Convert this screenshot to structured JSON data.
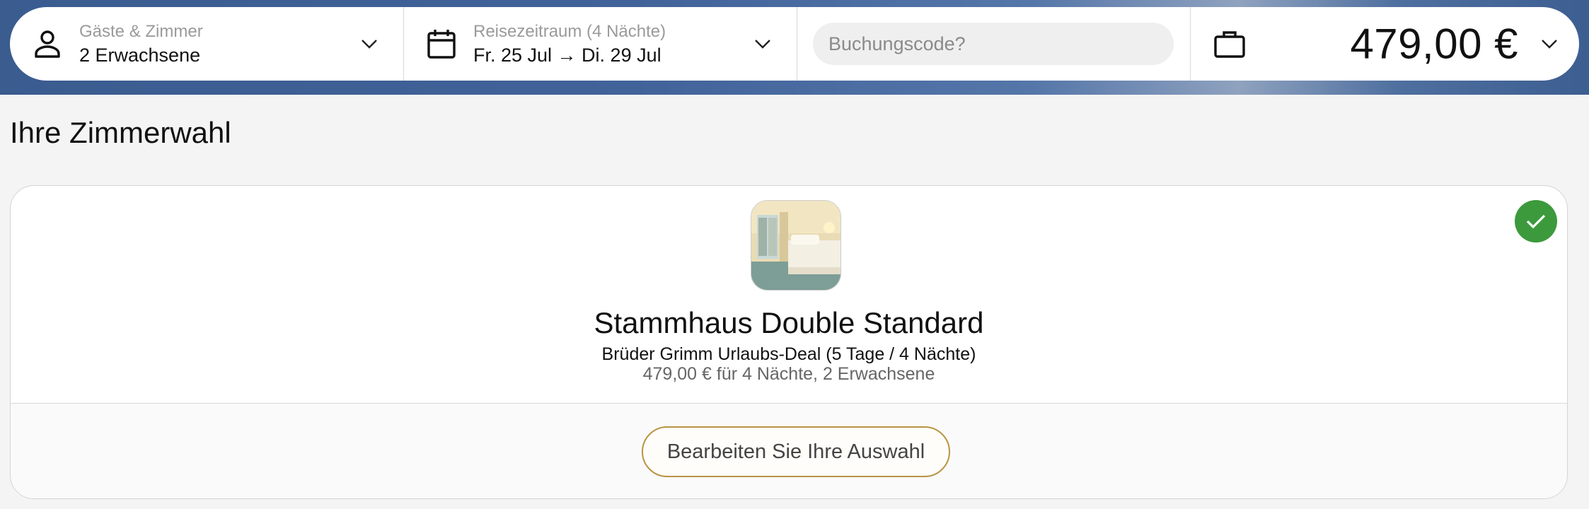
{
  "booking_bar": {
    "guests": {
      "label": "Gäste & Zimmer",
      "value": "2 Erwachsene",
      "icon": "person-icon"
    },
    "dates": {
      "label": "Reisezeitraum (4 Nächte)",
      "value": "Fr. 25 Jul → Di. 29 Jul",
      "icon": "calendar-icon"
    },
    "code": {
      "placeholder": "Buchungscode?"
    },
    "total": {
      "price": "479,00 €",
      "icon": "briefcase-icon"
    }
  },
  "section_title": "Ihre Zimmerwahl",
  "room": {
    "name": "Stammhaus Double Standard",
    "deal": "Brüder Grimm Urlaubs-Deal (5 Tage / 4 Nächte)",
    "price_line": "479,00 € für 4 Nächte, 2 Erwachsene",
    "selected": true,
    "edit_label": "Bearbeiten Sie Ihre Auswahl"
  },
  "colors": {
    "header_blue": "#3a5c8f",
    "check_green": "#3c9a3c",
    "button_border_gold": "#b99443"
  }
}
